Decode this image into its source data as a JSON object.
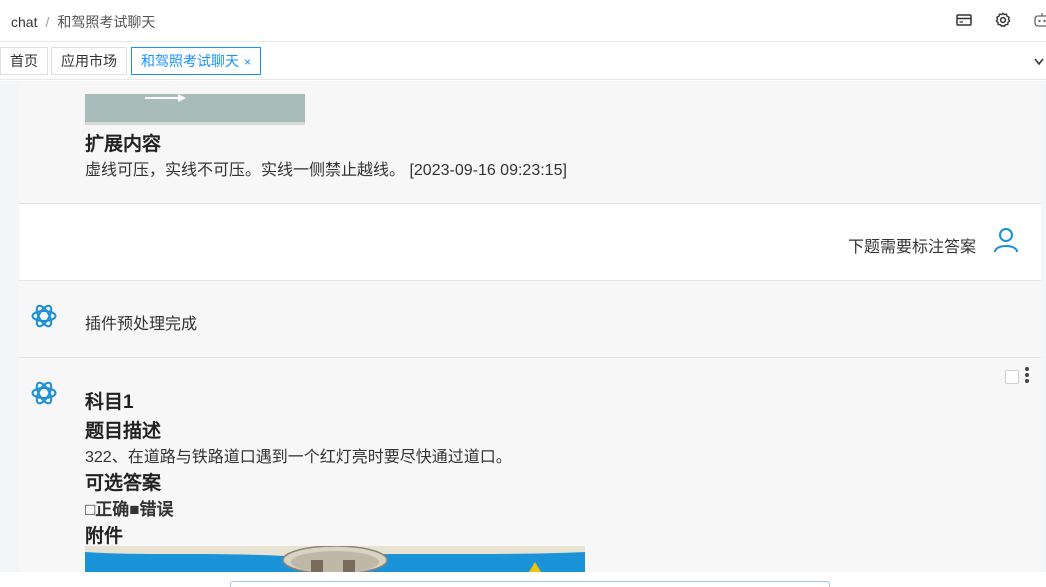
{
  "breadcrumb": {
    "root": "chat",
    "separator": "/",
    "current": "和驾照考试聊天"
  },
  "header_icons": [
    "card-icon",
    "gear-icon",
    "robot-icon"
  ],
  "tabs": [
    {
      "label": "首页",
      "active": false
    },
    {
      "label": "应用市场",
      "active": false
    },
    {
      "label": "和驾照考试聊天",
      "active": true,
      "close": "×"
    }
  ],
  "messages": {
    "extension": {
      "heading": "扩展内容",
      "text": "虚线可压，实线不可压。实线一侧禁止越线。 [2023-09-16 09:23:15]"
    },
    "user": {
      "text": "下题需要标注答案"
    },
    "plugin": {
      "text": "插件预处理完成"
    },
    "question": {
      "subject": "科目1",
      "desc_heading": "题目描述",
      "desc": "322、在道路与铁路道口遇到一个红灯亮时要尽快通过道口。",
      "options_heading": "可选答案",
      "options": "□正确■错误",
      "attachment_heading": "附件"
    }
  },
  "colors": {
    "accent": "#1890ff",
    "bot_icon": "#1a8fd6",
    "user_icon": "#1a8fd6"
  }
}
